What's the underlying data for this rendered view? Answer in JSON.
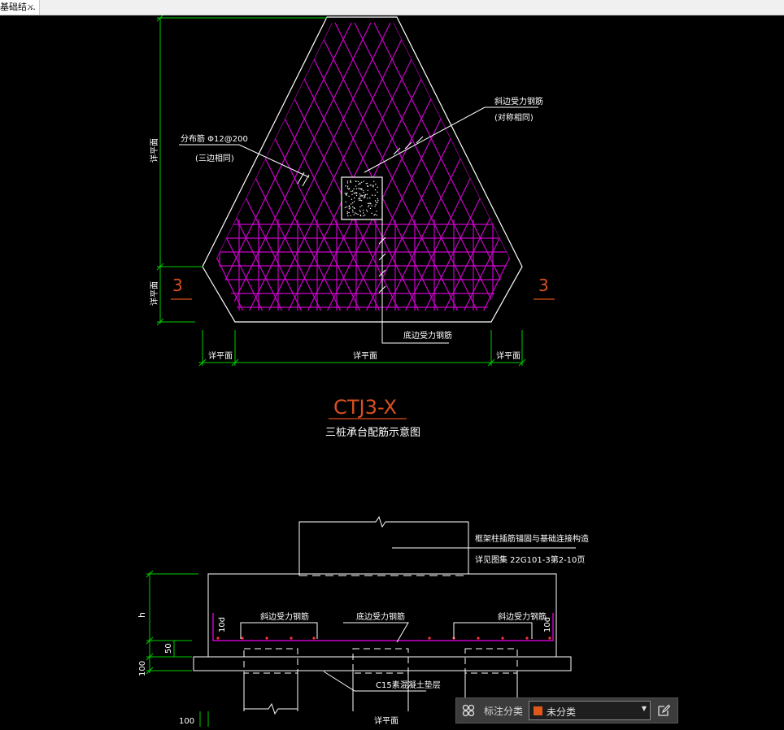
{
  "tab": {
    "title": "基础结…",
    "close": "×"
  },
  "colors": {
    "background": "#000000",
    "outline": "#ffffff",
    "rebar": "#cc00cc",
    "dimension": "#00cc00",
    "section_mark": "#d9501e",
    "red_dots": "#ff3333",
    "category_swatch": "#e0581c"
  },
  "plan": {
    "dist_rebar_label": "分布筋 Φ12@200",
    "dist_rebar_note": "(三边相同)",
    "slant_rebar_label": "斜边受力钢筋",
    "slant_rebar_note": "(对称相同)",
    "bottom_rebar_label": "底边受力钢筋",
    "dim_left_top": "详平面",
    "dim_left_bottom": "详平面",
    "dim_bottom_left": "详平面",
    "dim_bottom_mid": "详平面",
    "dim_bottom_right": "详平面",
    "section_left": "3",
    "section_right": "3",
    "title": "CTJ3-X",
    "subtitle": "三桩承台配筋示意图"
  },
  "section": {
    "column_note_1": "框架柱插筋锚固与基础连接构造",
    "column_note_2": "详见图集 22G101-3第2-10页",
    "slant_rebar_left": "斜边受力钢筋",
    "bottom_rebar": "底边受力钢筋",
    "slant_rebar_right": "斜边受力钢筋",
    "anchor_left": "10d",
    "anchor_right": "10d",
    "cushion_label": "C15素混凝土垫层",
    "dim_h": "h",
    "dim_50": "50",
    "dim_100_side": "100",
    "dim_100_bottom": "100",
    "dim_bottom_plan": "详平面"
  },
  "statusbar": {
    "grid_icon": "grid-icon",
    "label": "标注分类",
    "selected": "未分类",
    "edit_icon": "edit-icon"
  }
}
